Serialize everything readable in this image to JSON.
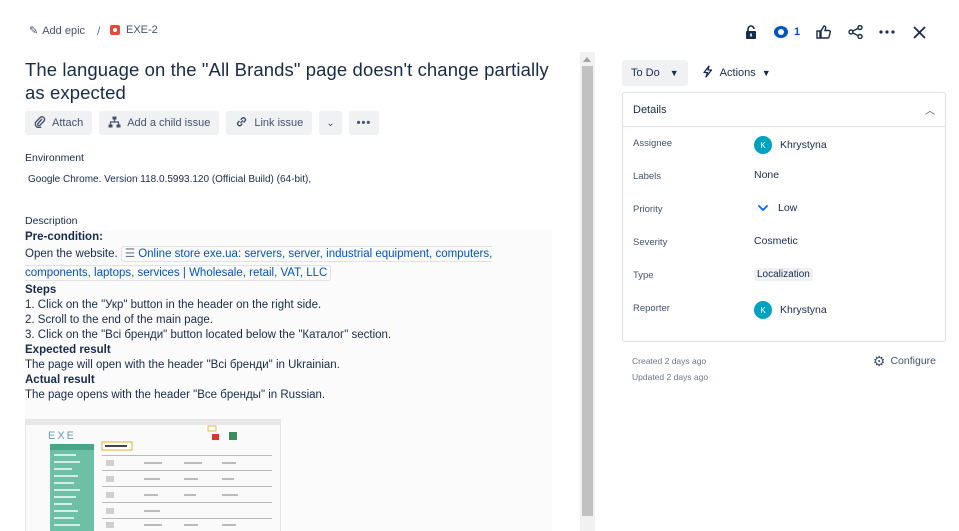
{
  "breadcrumb": {
    "add_epic": "Add epic",
    "separator": "/",
    "issue_key": "EXE-2"
  },
  "top_actions": {
    "watch_count": "1"
  },
  "issue": {
    "title": "The language on the \"All Brands\" page doesn't change partially as expected"
  },
  "toolbar": {
    "attach": "Attach",
    "add_child": "Add a child issue",
    "link_issue": "Link issue"
  },
  "environment": {
    "label": "Environment",
    "value": "Google Chrome. Version 118.0.5993.120 (Official Build) (64-bit),"
  },
  "description": {
    "label": "Description",
    "precondition_heading": "Pre-condition:",
    "precondition_text": "Open the website.",
    "link_text": "Online store exe.ua: servers, server, industrial equipment, computers, components, laptops, services | Wholesale, retail, VAT, LLC",
    "steps_heading": "Steps",
    "steps": [
      "1. Click on the \"Укр\" button in the header on the right side.",
      "2. Scroll to the end of the main page.",
      "3. Click on the \"Всі бренди\" button located below the \"Каталог\" section."
    ],
    "expected_heading": "Expected result",
    "expected_text": "The page will open with the header \"Всі бренди\" in Ukrainian.",
    "actual_heading": "Actual result",
    "actual_text": "The page opens with the header \"Все бренды\" in Russian."
  },
  "status": {
    "current": "To Do",
    "actions_label": "Actions"
  },
  "details": {
    "heading": "Details",
    "rows": [
      {
        "label": "Assignee",
        "value": "Khrystyna",
        "avatar": "K"
      },
      {
        "label": "Labels",
        "value": "None"
      },
      {
        "label": "Priority",
        "value": "Low"
      },
      {
        "label": "Severity",
        "value": "Cosmetic"
      },
      {
        "label": "Type",
        "value": "Localization"
      },
      {
        "label": "Reporter",
        "value": "Khrystyna",
        "avatar": "K"
      }
    ]
  },
  "meta": {
    "created": "Created 2 days ago",
    "updated": "Updated 2 days ago",
    "configure": "Configure"
  },
  "colors": {
    "accent": "#0052cc",
    "bug": "#e5493a",
    "avatar": "#00a3bf",
    "priority_low": "#0065ff"
  }
}
